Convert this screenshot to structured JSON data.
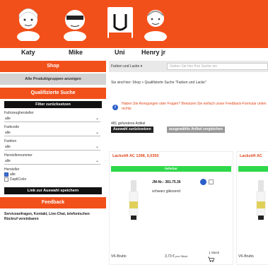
{
  "header": {
    "names": [
      "Katy",
      "Mike",
      "Uni",
      "Henry jr"
    ],
    "accent": "#f2501a"
  },
  "sidebar": {
    "shop_title": "Shop",
    "all_groups": "Alle Produktgruppen anzeigen",
    "qualified_title": "Qualifizierte Suche",
    "reset_filter": "Filter zurücksetzen",
    "filters": [
      {
        "label": "Fahrzeughersteller",
        "value": "alle"
      },
      {
        "label": "Farbcode",
        "value": "alle"
      },
      {
        "label": "Farbton",
        "value": "alle"
      },
      {
        "label": "Herstellernummer",
        "value": "alle"
      }
    ],
    "hersteller_label": "Hersteller",
    "checkboxes": [
      {
        "label": "alle",
        "checked": true
      },
      {
        "label": "DupliColor",
        "checked": false
      }
    ],
    "save_link": "Link zur Auswahl speichern",
    "feedback_title": "Feedback",
    "feedback_text": "Serviceanfragen, Kontakt, Live-Chat, telefonischen Rückruf vereinbaren"
  },
  "main": {
    "category_select": "Farben und Lacke",
    "search_placeholder": "Geben Sie hier Ihre Suche ein",
    "here_text": "Sie sind hier: Shop » Qualifizierte Suche \"Farben und Lacke\"",
    "info_text": "Haben Sie Anregungen oder Fragen? Benutzen Sie einfach unser Feedback-Formular unten rechts",
    "count": "481 gefundene Artikel",
    "reset_selection": "Auswahl zurücksetzen",
    "compare_selected": "ausgewählte Artikel vergleichen",
    "cards": [
      {
        "title": "Lackstift AC 1298, 0,0350",
        "availability": "lieferbar",
        "art_no": "JM-Nr.: 381.75.36",
        "color": "schwarz glänzend",
        "vk_label": "VK-Brutto",
        "price": "3,73 €",
        "price_unit": "pro Stück",
        "qty": "1 Stück"
      },
      {
        "title": "Lackstift AC",
        "availability": "",
        "vk_label": "VK-Brutto"
      }
    ]
  }
}
